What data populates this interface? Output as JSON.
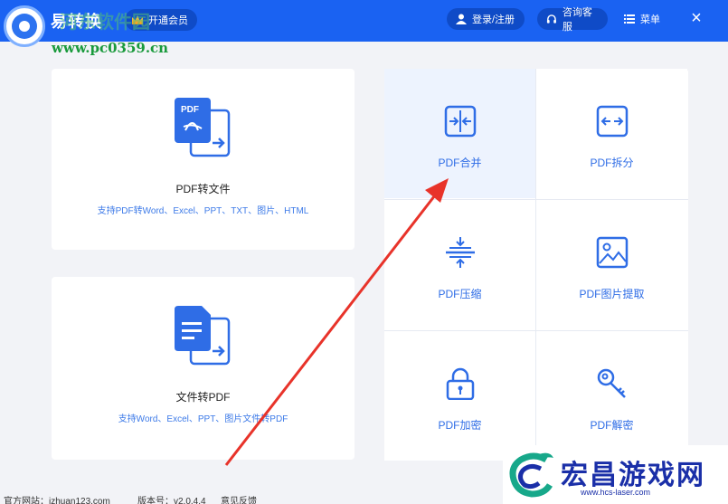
{
  "header": {
    "app_name": "易转换",
    "vip_label": "开通会员",
    "login_label": "登录/注册",
    "consult_label": "咨询客服",
    "menu_label": "菜单",
    "close_label": "×"
  },
  "watermark": {
    "line1": "河东软件园",
    "line2": "www.pc0359.cn"
  },
  "cards": {
    "pdf_to_file": {
      "title": "PDF转文件",
      "subtitle": "支持PDF转Word、Excel、PPT、TXT、图片、HTML"
    },
    "file_to_pdf": {
      "title": "文件转PDF",
      "subtitle": "支持Word、Excel、PPT、图片文件转PDF"
    }
  },
  "tools": [
    {
      "label": "PDF合并",
      "icon": "merge-icon"
    },
    {
      "label": "PDF拆分",
      "icon": "split-icon"
    },
    {
      "label": "PDF压缩",
      "icon": "compress-icon"
    },
    {
      "label": "PDF图片提取",
      "icon": "image-icon"
    },
    {
      "label": "PDF加密",
      "icon": "lock-icon"
    },
    {
      "label": "PDF解密",
      "icon": "key-icon"
    }
  ],
  "footer": {
    "website": "官方网站：izhuan123.com",
    "version": "版本号：v2.0.4.4",
    "feedback": "意见反馈"
  },
  "brand": {
    "name": "宏昌游戏网",
    "url": "www.hcs-laser.com"
  },
  "colors": {
    "topbar": "#1a62f2",
    "accent": "#2f6de6",
    "arrow": "#e8332a"
  }
}
